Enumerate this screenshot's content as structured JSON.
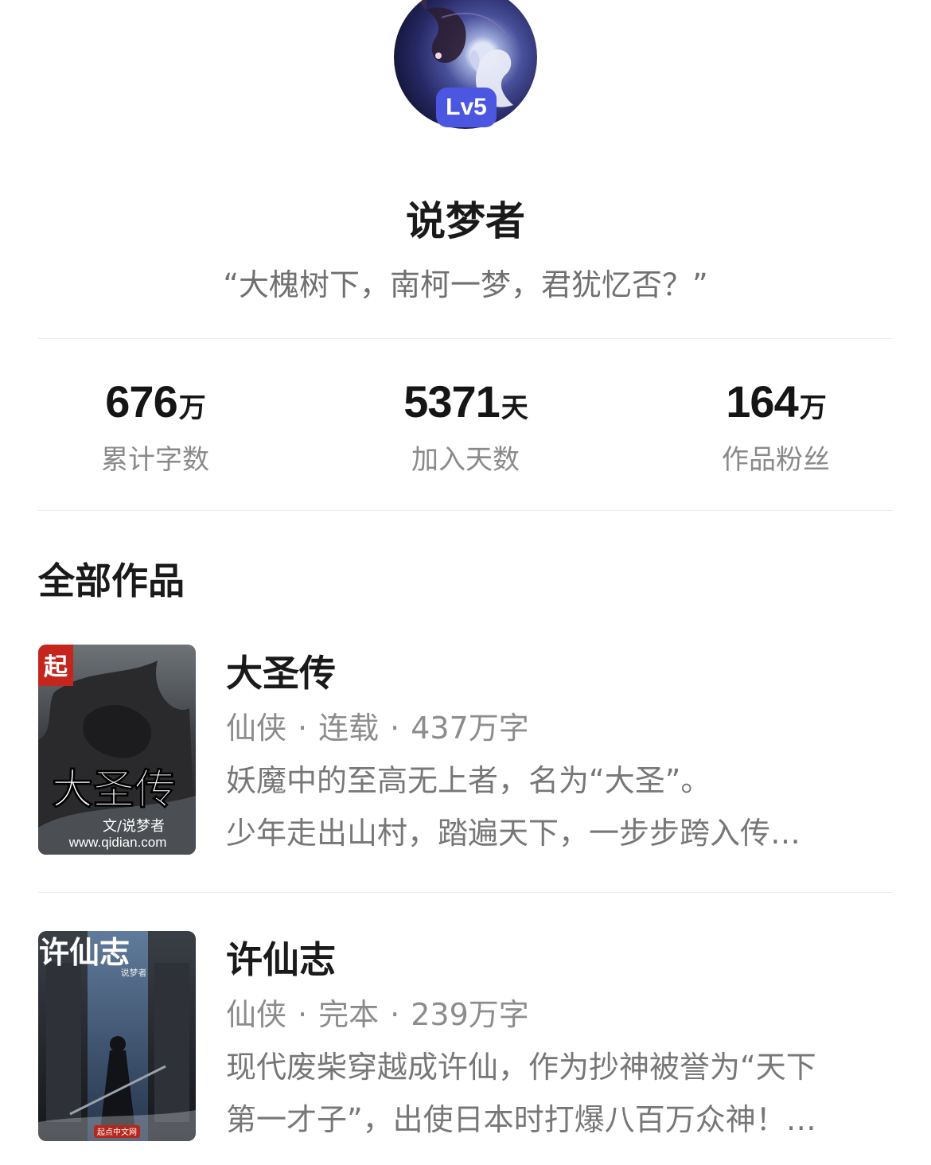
{
  "profile": {
    "level": "Lv5",
    "name": "说梦者",
    "motto": "“大槐树下，南柯一梦，君犹忆否？”"
  },
  "stats": [
    {
      "value": "676",
      "unit": "万",
      "label": "累计字数"
    },
    {
      "value": "5371",
      "unit": "天",
      "label": "加入天数"
    },
    {
      "value": "164",
      "unit": "万",
      "label": "作品粉丝"
    }
  ],
  "works": {
    "section_title": "全部作品",
    "books": [
      {
        "title": "大圣传",
        "genre": "仙侠",
        "status": "连载",
        "words": "437万字",
        "desc_line1": "妖魔中的至高无上者，名为“大圣”。",
        "desc_line2": "少年走出山村，踏遍天下，一步步跨入传…",
        "cover": {
          "badge": "起",
          "title_art": "大圣传",
          "author_line": "文/说梦者",
          "site": "www.qidian.com"
        }
      },
      {
        "title": "许仙志",
        "genre": "仙侠",
        "status": "完本",
        "words": "239万字",
        "desc_line1": "现代废柴穿越成许仙，作为抄神被誉为“天下",
        "desc_line2": "第一才子”，出使日本时打爆八百万众神！…",
        "cover": {
          "title_art": "许仙志",
          "author_line": "说梦者",
          "site": "起点中文网"
        }
      }
    ]
  },
  "colors": {
    "level_badge": "#4b57e0",
    "divider": "#ececec",
    "muted_text": "#8c8c8c"
  }
}
